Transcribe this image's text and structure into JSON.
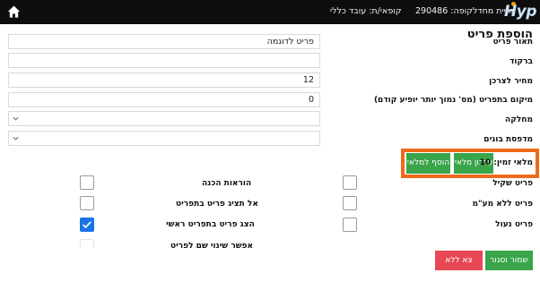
{
  "topbar": {
    "home_icon": "home-icon",
    "logo_text": "Hyp",
    "store_label": "בריית מחדל",
    "cashbox_label": "קופה: 290486",
    "cashier_label": "קופאי/ת: עובד כללי"
  },
  "form": {
    "title": "הוספת פריט",
    "description_label": "תאור פריט",
    "description_value": "פריט לדוגמה",
    "barcode_label": "ברקוד",
    "barcode_value": "",
    "price_label": "מחיר לצרכן",
    "price_value": "12",
    "position_label": "מיקום בתפריט (מס' נמוך יותר יופיע קודם)",
    "position_value": "0",
    "department_label": "מחלקה",
    "department_value": "",
    "printer_label": "מדפסת בונים",
    "printer_value": ""
  },
  "stock": {
    "label": "מלאי זמין: 10",
    "update_button": "עדכון מלאי",
    "add_button": "הוסף למלאי",
    "highlight_color": "#ef6a1a"
  },
  "options": {
    "weighable_label": "פריט שקיל",
    "no_vat_label": "פריט ללא מע\"מ",
    "locked_label": "פריט נעול",
    "prep_instructions_label": "הוראות הכנה",
    "hide_in_menu_label": "אל תציג פריט בתפריט",
    "show_in_main_menu_label": "הצג פריט בתפריט ראשי",
    "allow_rename_label": "אפשר שינוי שם לפריט",
    "weighable_checked": false,
    "no_vat_checked": false,
    "locked_checked": false,
    "prep_instructions_checked": false,
    "hide_in_menu_checked": false,
    "show_in_main_menu_checked": true
  },
  "footer": {
    "save_close_button": "שמור וסגור",
    "exit_without_save_button": "צא ללא שמירה",
    "save_color": "#3aa54a",
    "exit_color": "#e84855"
  }
}
